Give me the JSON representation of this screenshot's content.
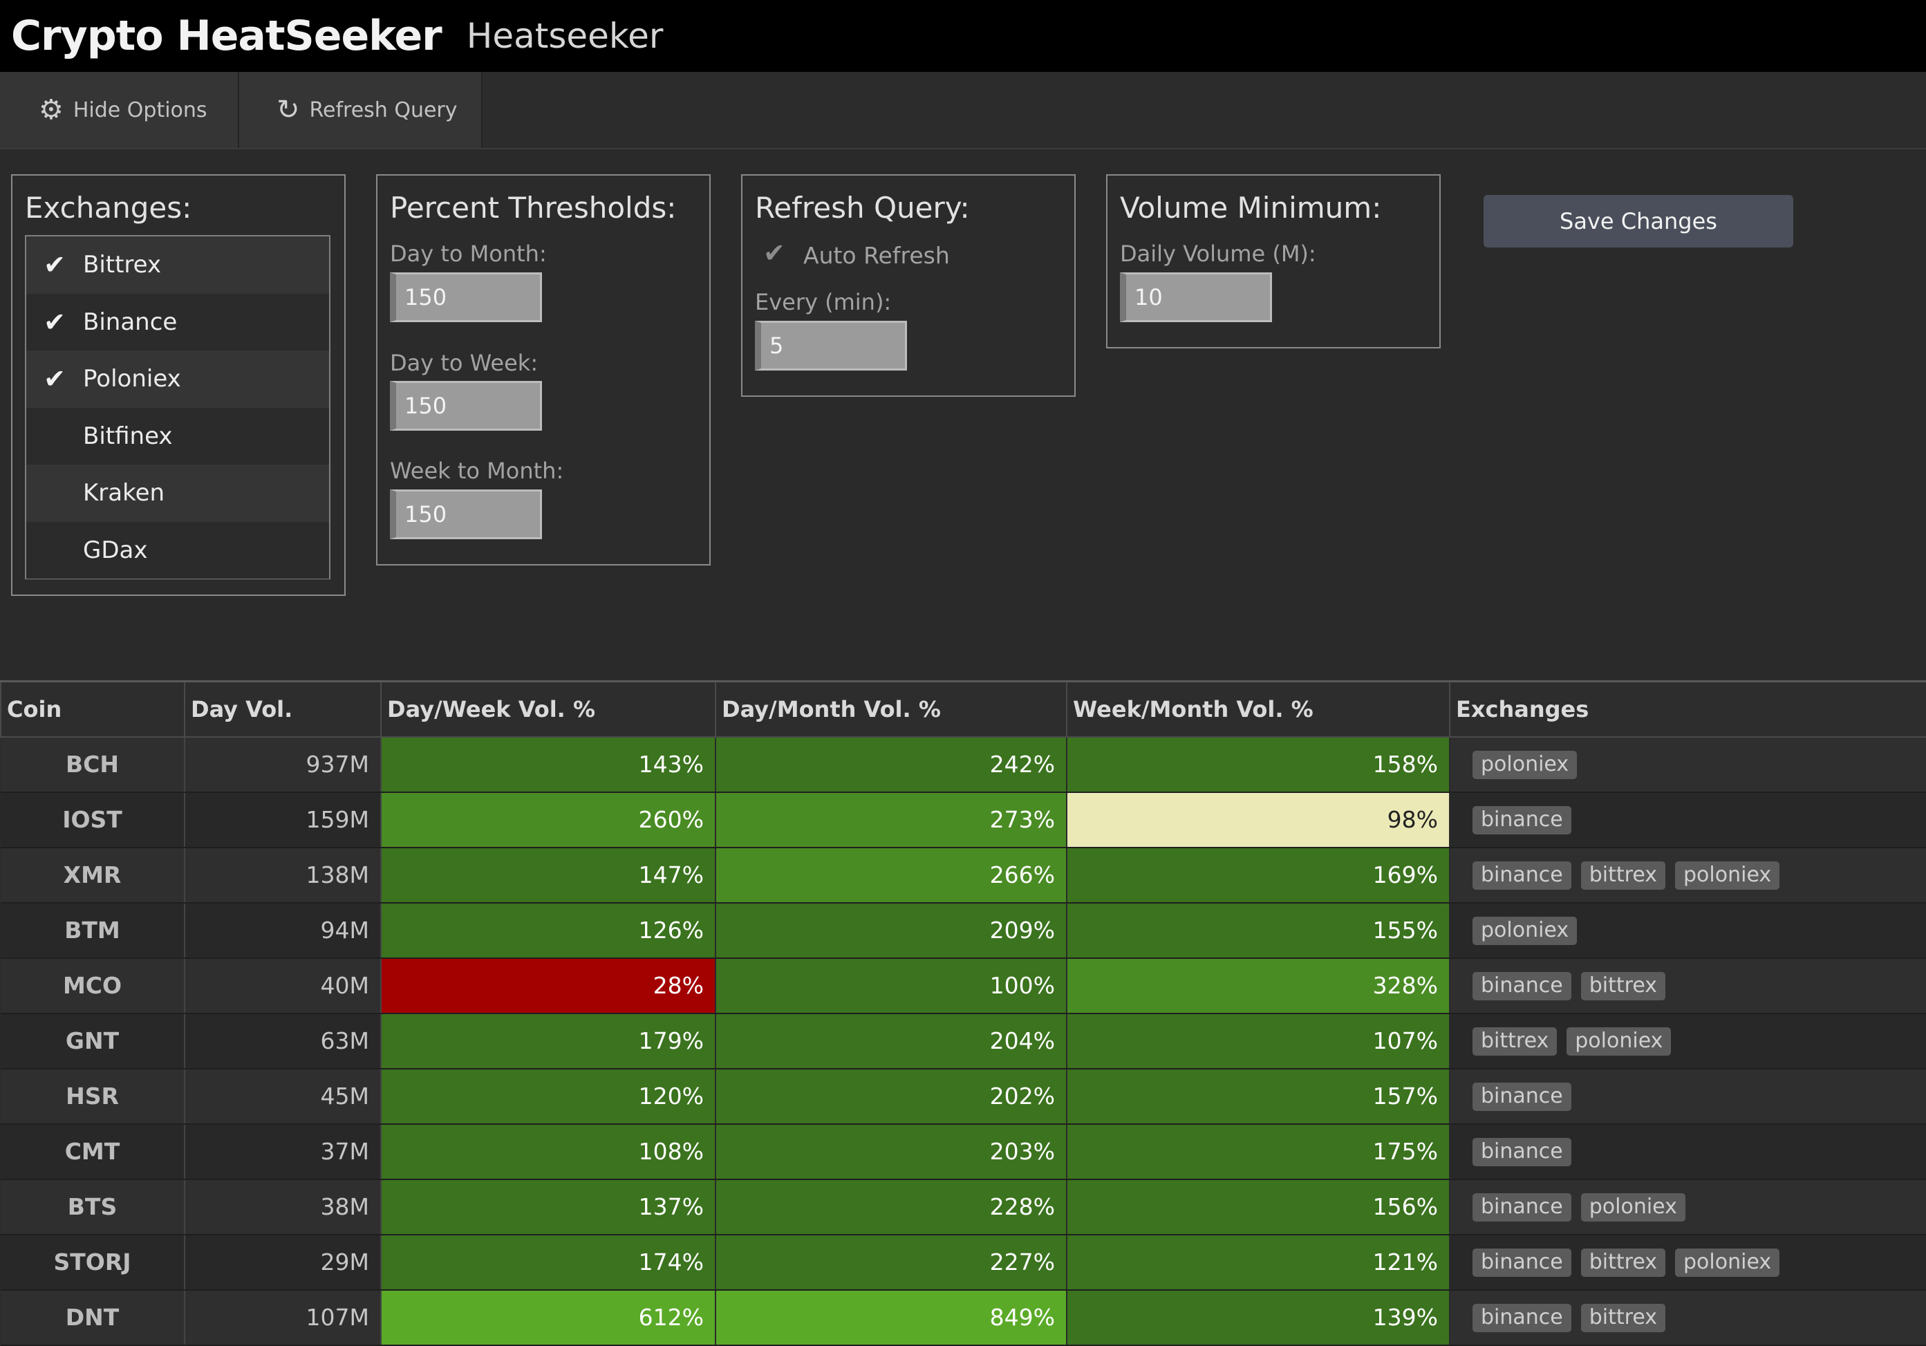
{
  "header": {
    "brand": "Crypto HeatSeeker",
    "subtitle": "Heatseeker"
  },
  "toolbar": {
    "hide_options": "Hide Options",
    "refresh_query": "Refresh Query",
    "hide_icon": "gear-icon",
    "refresh_icon": "refresh-icon"
  },
  "exchanges_panel": {
    "title": "Exchanges:",
    "items": [
      {
        "label": "Bittrex",
        "checked": true
      },
      {
        "label": "Binance",
        "checked": true
      },
      {
        "label": "Poloniex",
        "checked": true
      },
      {
        "label": "Bitfinex",
        "checked": false
      },
      {
        "label": "Kraken",
        "checked": false
      },
      {
        "label": "GDax",
        "checked": false
      }
    ]
  },
  "thresholds_panel": {
    "title": "Percent Thresholds:",
    "day_to_month_label": "Day to Month:",
    "day_to_month_value": "150",
    "day_to_week_label": "Day to Week:",
    "day_to_week_value": "150",
    "week_to_month_label": "Week to Month:",
    "week_to_month_value": "150"
  },
  "refresh_panel": {
    "title": "Refresh Query:",
    "auto_refresh_label": "Auto Refresh",
    "auto_refresh_checked": true,
    "every_label": "Every (min):",
    "every_value": "5"
  },
  "volume_panel": {
    "title": "Volume Minimum:",
    "daily_volume_label": "Daily Volume (M):",
    "daily_volume_value": "10"
  },
  "save_button": "Save Changes",
  "table": {
    "columns": [
      "Coin",
      "Day Vol.",
      "Day/Week Vol. %",
      "Day/Month Vol. %",
      "Week/Month Vol. %",
      "Exchanges"
    ],
    "colors": {
      "dark_green": "#3b731e",
      "mid_green": "#4a8c24",
      "bright_green": "#5aaa28",
      "red": "#a30000",
      "pale": "#ebe9b6"
    },
    "rows": [
      {
        "coin": "BCH",
        "vol": "937M",
        "dw": "143%",
        "dm": "242%",
        "wm": "158%",
        "dw_c": "dark_green",
        "dm_c": "dark_green",
        "wm_c": "dark_green",
        "exchanges": [
          "poloniex"
        ]
      },
      {
        "coin": "IOST",
        "vol": "159M",
        "dw": "260%",
        "dm": "273%",
        "wm": "98%",
        "dw_c": "mid_green",
        "dm_c": "mid_green",
        "wm_c": "pale",
        "exchanges": [
          "binance"
        ]
      },
      {
        "coin": "XMR",
        "vol": "138M",
        "dw": "147%",
        "dm": "266%",
        "wm": "169%",
        "dw_c": "dark_green",
        "dm_c": "mid_green",
        "wm_c": "dark_green",
        "exchanges": [
          "binance",
          "bittrex",
          "poloniex"
        ]
      },
      {
        "coin": "BTM",
        "vol": "94M",
        "dw": "126%",
        "dm": "209%",
        "wm": "155%",
        "dw_c": "dark_green",
        "dm_c": "dark_green",
        "wm_c": "dark_green",
        "exchanges": [
          "poloniex"
        ]
      },
      {
        "coin": "MCO",
        "vol": "40M",
        "dw": "28%",
        "dm": "100%",
        "wm": "328%",
        "dw_c": "red",
        "dm_c": "dark_green",
        "wm_c": "mid_green",
        "exchanges": [
          "binance",
          "bittrex"
        ]
      },
      {
        "coin": "GNT",
        "vol": "63M",
        "dw": "179%",
        "dm": "204%",
        "wm": "107%",
        "dw_c": "dark_green",
        "dm_c": "dark_green",
        "wm_c": "dark_green",
        "exchanges": [
          "bittrex",
          "poloniex"
        ]
      },
      {
        "coin": "HSR",
        "vol": "45M",
        "dw": "120%",
        "dm": "202%",
        "wm": "157%",
        "dw_c": "dark_green",
        "dm_c": "dark_green",
        "wm_c": "dark_green",
        "exchanges": [
          "binance"
        ]
      },
      {
        "coin": "CMT",
        "vol": "37M",
        "dw": "108%",
        "dm": "203%",
        "wm": "175%",
        "dw_c": "dark_green",
        "dm_c": "dark_green",
        "wm_c": "dark_green",
        "exchanges": [
          "binance"
        ]
      },
      {
        "coin": "BTS",
        "vol": "38M",
        "dw": "137%",
        "dm": "228%",
        "wm": "156%",
        "dw_c": "dark_green",
        "dm_c": "dark_green",
        "wm_c": "dark_green",
        "exchanges": [
          "binance",
          "poloniex"
        ]
      },
      {
        "coin": "STORJ",
        "vol": "29M",
        "dw": "174%",
        "dm": "227%",
        "wm": "121%",
        "dw_c": "dark_green",
        "dm_c": "dark_green",
        "wm_c": "dark_green",
        "exchanges": [
          "binance",
          "bittrex",
          "poloniex"
        ]
      },
      {
        "coin": "DNT",
        "vol": "107M",
        "dw": "612%",
        "dm": "849%",
        "wm": "139%",
        "dw_c": "bright_green",
        "dm_c": "bright_green",
        "wm_c": "dark_green",
        "exchanges": [
          "binance",
          "bittrex"
        ]
      }
    ]
  }
}
